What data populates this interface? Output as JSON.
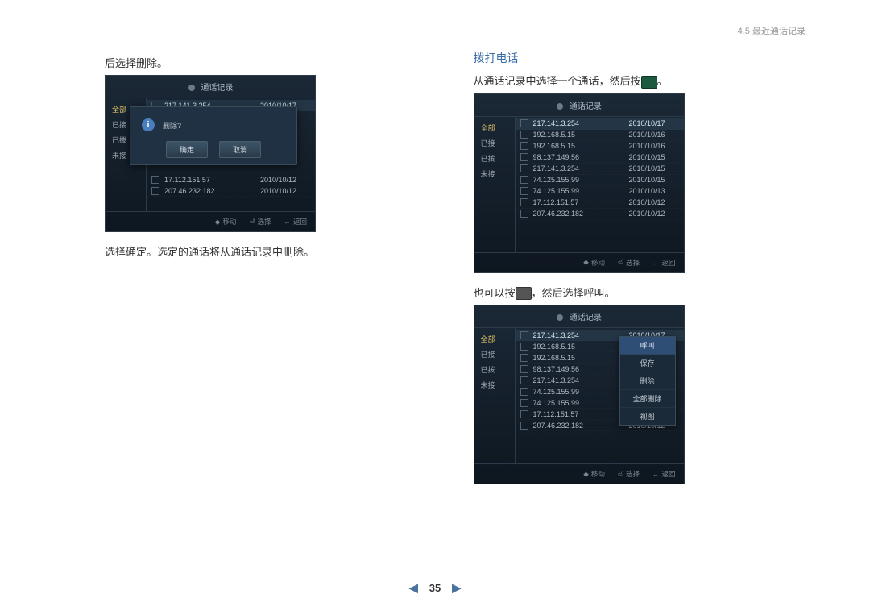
{
  "header": {
    "section": "4.5 最近通话记录"
  },
  "left": {
    "caption_top": "后选择删除。",
    "caption_bottom": "选择确定。选定的通话将从通话记录中删除。"
  },
  "right": {
    "section_title": "拨打电话",
    "caption_top_a": "从通话记录中选择一个通话，然后按",
    "caption_top_b": "。",
    "caption_mid_a": "也可以按",
    "caption_mid_b": "，然后选择呼叫。"
  },
  "ui": {
    "title": "通话记录",
    "side": {
      "all": "全部",
      "received": "已接",
      "dialed": "已拨",
      "missed": "未接"
    },
    "footer": {
      "move": "移动",
      "select": "选择",
      "back": "返回"
    }
  },
  "dialog": {
    "msg": "删除?",
    "ok": "确定",
    "cancel": "取消"
  },
  "menu": {
    "call": "呼叫",
    "save": "保存",
    "delete": "删除",
    "delete_all": "全部删除",
    "view": "视图"
  },
  "rows_full": [
    {
      "ip": "217.141.3.254",
      "date": "2010/10/17"
    },
    {
      "ip": "192.168.5.15",
      "date": "2010/10/16"
    },
    {
      "ip": "192.168.5.15",
      "date": "2010/10/16"
    },
    {
      "ip": "98.137.149.56",
      "date": "2010/10/15"
    },
    {
      "ip": "217.141.3.254",
      "date": "2010/10/15"
    },
    {
      "ip": "74.125.155.99",
      "date": "2010/10/15"
    },
    {
      "ip": "74.125.155.99",
      "date": "2010/10/13"
    },
    {
      "ip": "17.112.151.57",
      "date": "2010/10/12"
    },
    {
      "ip": "207.46.232.182",
      "date": "2010/10/12"
    }
  ],
  "rows_left_visible": [
    {
      "ip": "217.141.3.254",
      "date": "2010/10/17"
    },
    {
      "ip": "192.168.5.15",
      "date": "2010/10/16"
    },
    {
      "ip": "17.112.151.57",
      "date": "2010/10/12"
    },
    {
      "ip": "207.46.232.182",
      "date": "2010/10/12"
    }
  ],
  "pager": {
    "num": "35"
  }
}
